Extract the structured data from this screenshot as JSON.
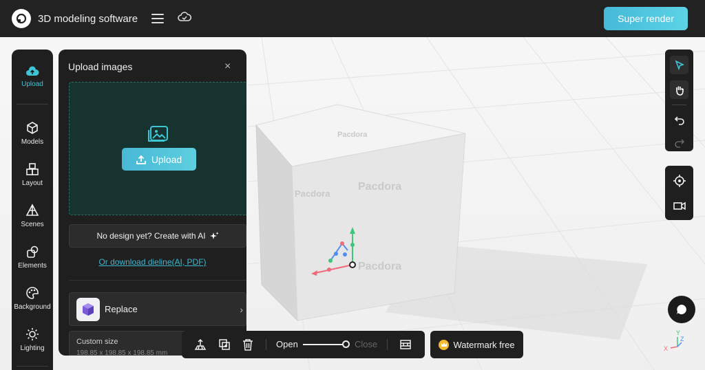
{
  "app": {
    "title": "3D modeling software",
    "super_render": "Super render"
  },
  "icons": {
    "logo": "app-logo",
    "menu": "hamburger-menu-icon",
    "cloud": "cloud-icon",
    "upload": "cloud-upload-icon",
    "models": "cube-icon",
    "layout": "layout-blocks-icon",
    "scenes": "scene-icon",
    "elements": "elements-icon",
    "background": "palette-icon",
    "lighting": "sun-icon",
    "select": "pointer-icon",
    "pan": "hand-icon",
    "undo": "undo-icon",
    "redo": "redo-icon",
    "target": "crosshair-icon",
    "camera": "camera-view-icon",
    "chat": "chat-bubble-icon",
    "crown": "crown-icon"
  },
  "colors": {
    "accent": "#3fc6d6",
    "topbar": "#222222",
    "panel": "#1f1f1f",
    "dropzone": "#17332f",
    "crown": "#f2b933"
  },
  "sidebar": {
    "items": [
      {
        "label": "Upload",
        "active": true
      },
      {
        "label": "Models"
      },
      {
        "label": "Layout"
      },
      {
        "label": "Scenes"
      },
      {
        "label": "Elements"
      },
      {
        "label": "Background"
      },
      {
        "label": "Lighting"
      }
    ]
  },
  "upload_panel": {
    "title": "Upload images",
    "close": "×",
    "upload_button": "Upload",
    "ai_button": "No design yet? Create with AI",
    "dieline_link": "Or download dieline(AI, PDF)",
    "replace_label": "Replace",
    "replace_chevron": "›",
    "custom_size_label": "Custom size",
    "custom_size_dims": "198.85 x 198.85 x 198.85 mm"
  },
  "bottom_bar": {
    "open_label": "Open",
    "close_label": "Close",
    "slider_value": 1.0
  },
  "watermark": {
    "label": "Watermark free"
  },
  "viewport": {
    "brand_watermark": "Pacdora",
    "axes": {
      "x": "X",
      "y": "Y",
      "z": "Z"
    }
  }
}
